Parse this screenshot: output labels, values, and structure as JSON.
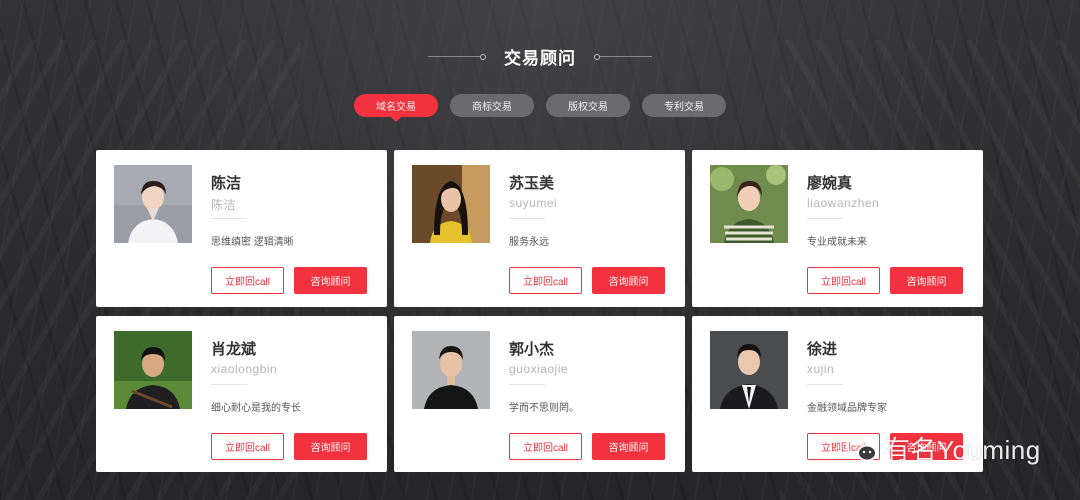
{
  "section": {
    "title": "交易顾问"
  },
  "tabs": [
    {
      "label": "域名交易",
      "active": true
    },
    {
      "label": "商标交易",
      "active": false
    },
    {
      "label": "版权交易",
      "active": false
    },
    {
      "label": "专利交易",
      "active": false
    }
  ],
  "advisors": [
    {
      "name": "陈洁",
      "pinyin": "陈洁",
      "desc": "思维缜密 逻辑清晰",
      "call": "立即回call",
      "consult": "咨询顾问"
    },
    {
      "name": "苏玉美",
      "pinyin": "suyumei",
      "desc": "服务永远",
      "call": "立即回call",
      "consult": "咨询顾问"
    },
    {
      "name": "廖婉真",
      "pinyin": "liaowanzhen",
      "desc": "专业成就未来",
      "call": "立即回call",
      "consult": "咨询顾问"
    },
    {
      "name": "肖龙斌",
      "pinyin": "xiaolongbin",
      "desc": "细心耐心是我的专长",
      "call": "立即回call",
      "consult": "咨询顾问"
    },
    {
      "name": "郭小杰",
      "pinyin": "guoxiaojie",
      "desc": "学而不思则罔。",
      "call": "立即回call",
      "consult": "咨询顾问"
    },
    {
      "name": "徐进",
      "pinyin": "xujin",
      "desc": "金融领域品牌专家",
      "call": "立即回call",
      "consult": "咨询顾问"
    }
  ],
  "watermark": {
    "text": "有名Youming",
    "icon": "wechat-icon"
  },
  "colors": {
    "accent": "#f2333f",
    "background": "#2b2b2d",
    "tab_inactive": "#6b6b6d"
  }
}
